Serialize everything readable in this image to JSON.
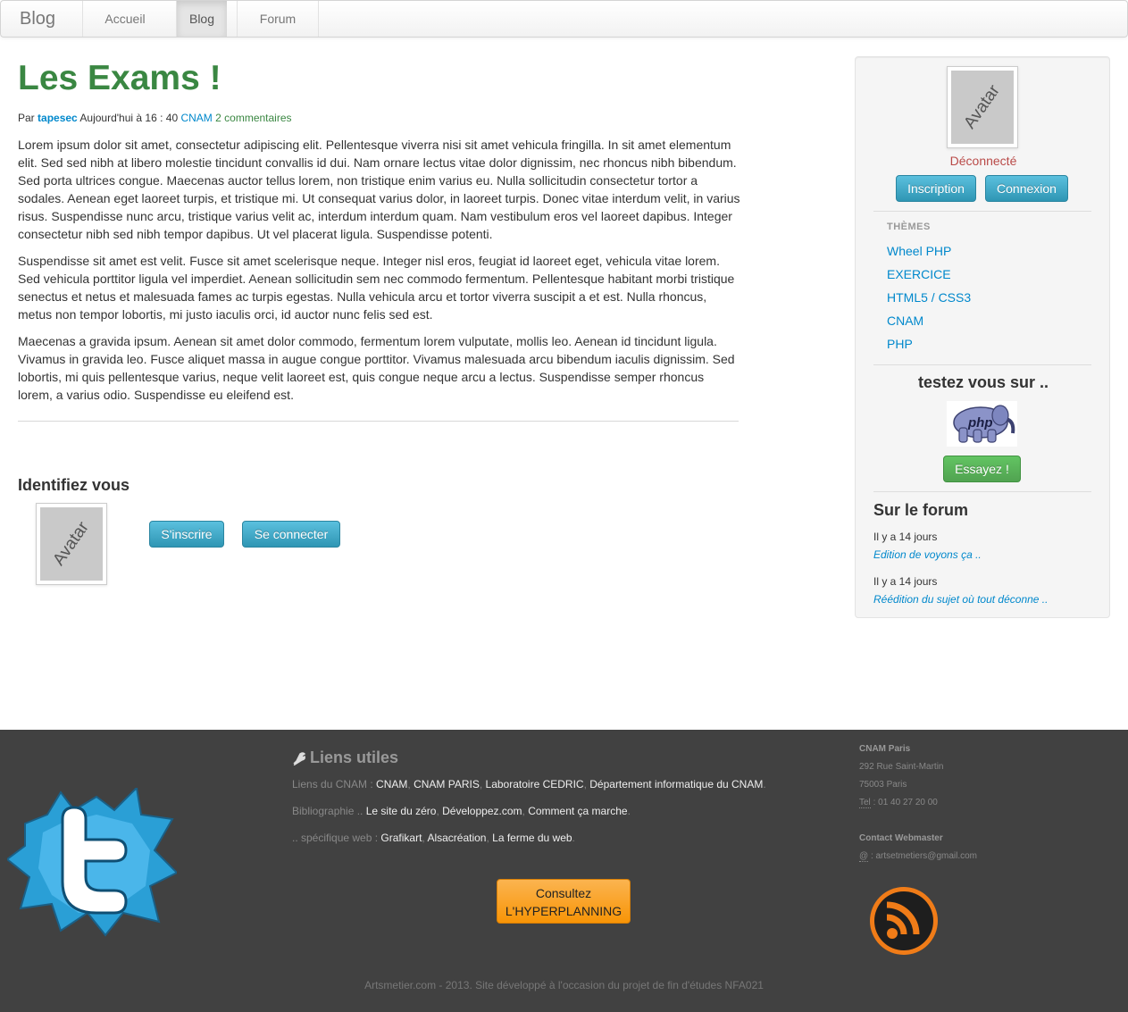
{
  "nav": {
    "brand": "Blog",
    "items": [
      {
        "label": "Accueil"
      },
      {
        "label": "Blog"
      },
      {
        "label": "Forum"
      }
    ]
  },
  "post": {
    "title": "Les Exams !",
    "meta": {
      "by": "Par",
      "author": "tapesec",
      "date": "Aujourd'hui à 16 : 40",
      "category": "CNAM",
      "comments": "2 commentaires"
    },
    "paragraphs": [
      "Lorem ipsum dolor sit amet, consectetur adipiscing elit. Pellentesque viverra nisi sit amet vehicula fringilla. In sit amet elementum elit. Sed sed nibh at libero molestie tincidunt convallis id dui. Nam ornare lectus vitae dolor dignissim, nec rhoncus nibh bibendum. Sed porta ultrices congue. Maecenas auctor tellus lorem, non tristique enim varius eu. Nulla sollicitudin consectetur tortor a sodales. Aenean eget laoreet turpis, et tristique mi. Ut consequat varius dolor, in laoreet turpis. Donec vitae interdum velit, in varius risus. Suspendisse nunc arcu, tristique varius velit ac, interdum interdum quam. Nam vestibulum eros vel laoreet dapibus. Integer consectetur nibh sed nibh tempor dapibus. Ut vel placerat ligula. Suspendisse potenti.",
      "Suspendisse sit amet est velit. Fusce sit amet scelerisque neque. Integer nisl eros, feugiat id laoreet eget, vehicula vitae lorem. Sed vehicula porttitor ligula vel imperdiet. Aenean sollicitudin sem nec commodo fermentum. Pellentesque habitant morbi tristique senectus et netus et malesuada fames ac turpis egestas. Nulla vehicula arcu et tortor viverra suscipit a et est. Nulla rhoncus, metus non tempor lobortis, mi justo iaculis orci, id auctor nunc felis sed est.",
      "Maecenas a gravida ipsum. Aenean sit amet dolor commodo, fermentum lorem vulputate, mollis leo. Aenean id tincidunt ligula. Vivamus in gravida leo. Fusce aliquet massa in augue congue porttitor. Vivamus malesuada arcu bibendum iaculis dignissim. Sed lobortis, mi quis pellentesque varius, neque velit laoreet est, quis congue neque arcu a lectus. Suspendisse semper rhoncus lorem, a varius odio. Suspendisse eu eleifend est."
    ]
  },
  "identify": {
    "title": "Identifiez vous",
    "avatar_text": "Avatar",
    "signup": "S'inscrire",
    "login": "Se connecter"
  },
  "sidebar": {
    "avatar_text": "Avatar",
    "status": "Déconnecté",
    "inscription": "Inscription",
    "connexion": "Connexion",
    "themes_header": "THÈMES",
    "themes": [
      "Wheel PHP",
      "EXERCICE",
      "HTML5 / CSS3",
      "CNAM",
      "PHP"
    ],
    "test_title": "testez vous sur ..",
    "php_logo": "php",
    "try_button": "Essayez !",
    "forum_title": "Sur le forum",
    "forum": [
      {
        "time": "Il y a 14 jours",
        "link": "Edition de voyons ça .."
      },
      {
        "time": "Il y a 14 jours",
        "link": "Réédition du sujet où tout déconne .."
      }
    ]
  },
  "footer": {
    "liens_title": "Liens utiles",
    "line1_label": "Liens du CNAM :",
    "line1_links": [
      "CNAM",
      "CNAM PARIS",
      "Laboratoire CEDRIC",
      "Département informatique du CNAM"
    ],
    "line2_label": "Bibliographie ..",
    "line2_links": [
      "Le site du zéro",
      "Développez.com",
      "Comment ça marche"
    ],
    "line3_label": ".. spécifique web :",
    "line3_links": [
      "Grafikart",
      "Alsacréation",
      "La ferme du web"
    ],
    "hyper_line1": "Consultez",
    "hyper_line2": "L'HYPERPLANNING",
    "contact_title": "CNAM Paris",
    "address1": "292 Rue Saint-Martin",
    "address2": "75003 Paris",
    "tel_label": "Tel",
    "tel": ": 01 40 27 20 00",
    "webmaster_title": "Contact Webmaster",
    "email_label": "@",
    "email": ": artsetmetiers@gmail.com",
    "copyright": "Artsmetier.com - 2013. Site développé à l'occasion du projet de fin d'études NFA021"
  },
  "colors": {
    "title_green": "#3a8742",
    "link_blue": "#0088cc",
    "status_red": "#b94a48",
    "footer_bg": "#414141"
  }
}
